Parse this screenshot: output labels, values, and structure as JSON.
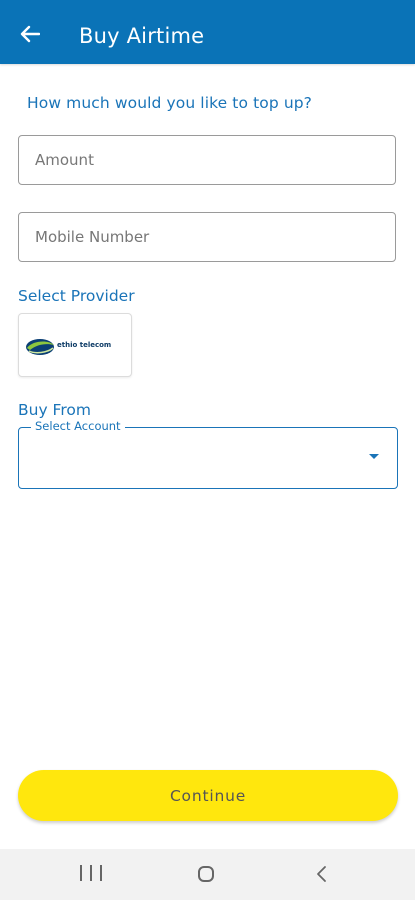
{
  "app_bar": {
    "title": "Buy Airtime",
    "back_icon": "arrow-left-icon",
    "background_color": "#0a73b7"
  },
  "form": {
    "prompt": "How much would you like to top up?",
    "amount_field": {
      "placeholder": "Amount",
      "value": ""
    },
    "mobile_field": {
      "placeholder": "Mobile Number",
      "value": ""
    },
    "provider_section_label": "Select Provider",
    "providers": [
      {
        "name": "ethio telecom",
        "icon": "ethio-telecom-logo"
      }
    ],
    "buy_from_label": "Buy From",
    "account_select": {
      "label": "Select Account",
      "value": ""
    }
  },
  "continue_button": {
    "label": "Continue",
    "color": "#ffe70d"
  },
  "nav_bar": {
    "recents_icon": "recents-icon",
    "home_icon": "home-icon",
    "back_icon": "back-chevron-icon"
  },
  "colors": {
    "accent": "#1a74b8"
  }
}
